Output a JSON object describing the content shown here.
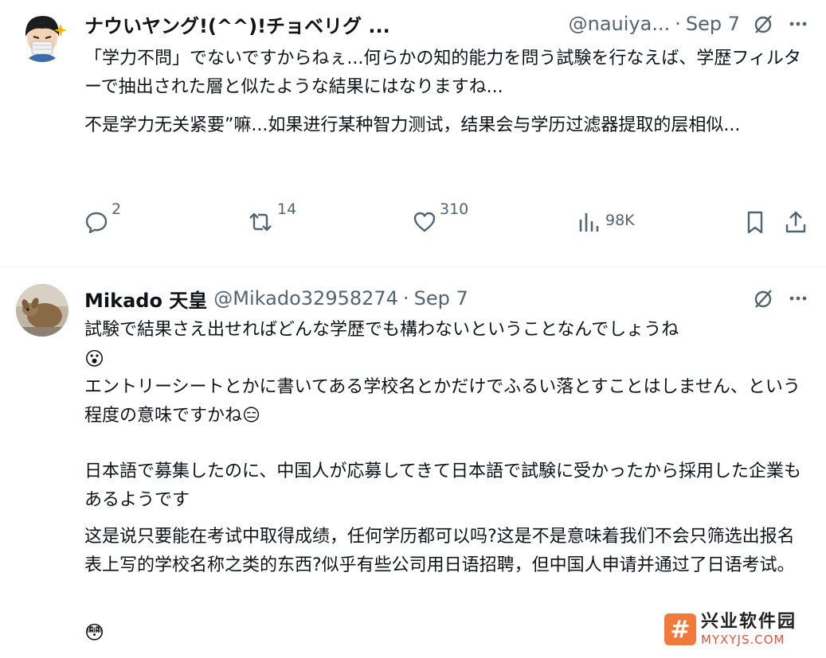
{
  "tweets": [
    {
      "name": "ナウいヤング!(^^)!チョベリグ ...",
      "handle": "@nauiya...",
      "separator": "·",
      "date": "Sep 7",
      "jp_text": "「学力不問」でないですからねぇ...何らかの知的能力を問う試験を行なえば、学歴フィルターで抽出された層と似たような結果にはなりますね...",
      "cn_text": "不是学力无关紧要”嘛...如果进行某种智力测试，结果会与学历过滤器提取的层相似...",
      "stats": {
        "replies": "2",
        "retweets": "14",
        "likes": "310",
        "views": "98K"
      }
    },
    {
      "name": "Mikado 天皇",
      "handle": "@Mikado32958274",
      "separator": "·",
      "date": "Sep 7",
      "jp_text_1": "試験で結果さえ出せればどんな学歴でも構わないということなんでしょうね",
      "emoji_1": "😮",
      "jp_text_2": "エントリーシートとかに書いてある学校名とかだけでふるい落とすことはしません、という程度の意味ですかね",
      "emoji_2": "😑",
      "jp_text_3": "日本語で募集したのに、中国人が応募してきて日本語で試験に受かったから採用した企業もあるようです",
      "cn_text": "这是说只要能在考试中取得成绩，任何学历都可以吗?这是不是意味着我们不会只筛选出报名表上写的学校名称之类的东西?似乎有些公司用日语招聘，但中国人申请并通过了日语考试。",
      "emoji_3": "😳"
    }
  ],
  "watermark": {
    "logo_glyph": "#",
    "cn": "兴业软件园",
    "en": "MYXYJS.COM"
  },
  "colors": {
    "text": "#0f1419",
    "secondary": "#536471",
    "divider": "#eff3f4",
    "watermark_accent": "#f07a3c"
  }
}
